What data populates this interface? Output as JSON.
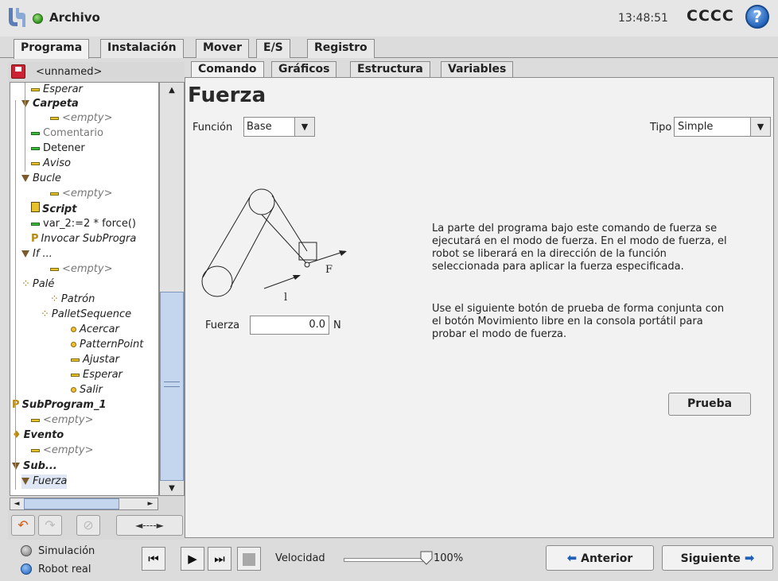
{
  "header": {
    "file_label": "Archivo",
    "time": "13:48:51",
    "robot_name": "CCCC",
    "help_icon": "?"
  },
  "main_tabs": [
    {
      "label": "Programa",
      "active": true
    },
    {
      "label": "Instalación",
      "active": false
    },
    {
      "label": "Mover",
      "active": false
    },
    {
      "label": "E/S",
      "active": false
    },
    {
      "label": "Registro",
      "active": false
    }
  ],
  "sidebar": {
    "file_name": "<unnamed>",
    "tree": [
      {
        "label": "Esperar"
      },
      {
        "label": "Carpeta"
      },
      {
        "label": "<empty>"
      },
      {
        "label": "Comentario"
      },
      {
        "label": "Detener"
      },
      {
        "label": "Aviso"
      },
      {
        "label": "Bucle"
      },
      {
        "label": "<empty>"
      },
      {
        "label": "Script"
      },
      {
        "label": "var_2:=2 * force()"
      },
      {
        "label": "Invocar SubProgra"
      },
      {
        "label": "If ..."
      },
      {
        "label": "<empty>"
      },
      {
        "label": "Palé"
      },
      {
        "label": "Patrón"
      },
      {
        "label": "PalletSequence"
      },
      {
        "label": "Acercar"
      },
      {
        "label": "PatternPoint"
      },
      {
        "label": "Ajustar"
      },
      {
        "label": "Esperar"
      },
      {
        "label": "Salir"
      },
      {
        "label": "SubProgram_1"
      },
      {
        "label": "<empty>"
      },
      {
        "label": "Evento"
      },
      {
        "label": "<empty>"
      },
      {
        "label": "Sub..."
      },
      {
        "label": "Fuerza"
      }
    ],
    "move_button_label": "◄----►"
  },
  "sub_tabs": [
    {
      "label": "Comando",
      "active": true
    },
    {
      "label": "Gráficos",
      "active": false
    },
    {
      "label": "Estructura",
      "active": false
    },
    {
      "label": "Variables",
      "active": false
    }
  ],
  "command": {
    "title": "Fuerza",
    "funcion_label": "Función",
    "funcion_value": "Base",
    "tipo_label": "Tipo",
    "tipo_value": "Simple",
    "fuerza_label": "Fuerza",
    "fuerza_value": "0.0",
    "fuerza_unit": "N",
    "diagram_label_f": "F",
    "diagram_label_l": "l",
    "description_1": "La parte del programa bajo este comando de fuerza se ejecutará en el modo de fuerza. En el modo de fuerza, el robot se liberará en la dirección de la función seleccionada para aplicar la fuerza especificada.",
    "description_2": "Use el siguiente botón de prueba de forma conjunta con el botón Movimiento libre en la consola portátil para probar el modo de fuerza.",
    "test_button": "Prueba"
  },
  "footer": {
    "simulation_label": "Simulación",
    "real_robot_label": "Robot real",
    "speed_label": "Velocidad",
    "speed_value": "100%",
    "speed_fraction": 1.0,
    "prev_label": "Anterior",
    "next_label": "Siguiente"
  },
  "colors": {
    "accent_blue": "#1f5fb8",
    "status_green": "#2f8f1f",
    "scroll_thumb": "#c4d6ee"
  }
}
